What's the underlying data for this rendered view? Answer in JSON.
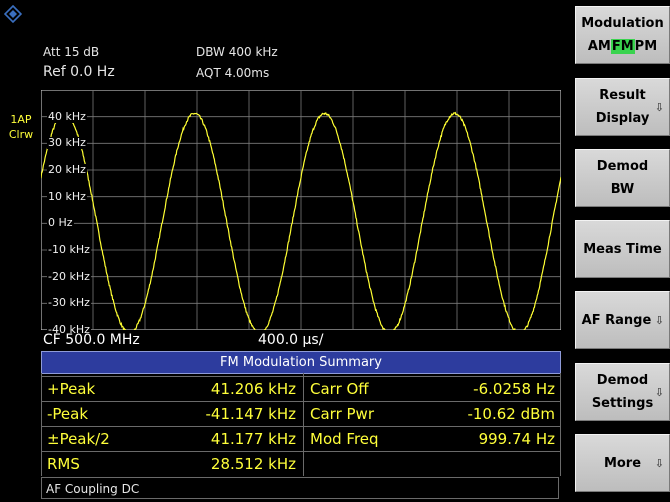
{
  "header": {
    "att_label": "Att  15 dB",
    "ref_label": "Ref  0.0 Hz",
    "dbw_label": "DBW 400 kHz",
    "aqt_label": "AQT  4.00ms"
  },
  "side_labels": {
    "trace": "1AP",
    "mode": "Clrw"
  },
  "logo_icon": "rohde-schwarz-logo-icon",
  "chart_data": {
    "type": "line",
    "x_axis": {
      "center_label": "CF 500.0 MHz",
      "div_label": "400.0 µs/",
      "divisions": 10,
      "sweep_time_ms": 4.0
    },
    "y_axis": {
      "ticks": [
        "40 kHz",
        "30 kHz",
        "20 kHz",
        "10 kHz",
        "0 Hz",
        "-10 kHz",
        "-20 kHz",
        "-30 kHz",
        "-40 kHz"
      ],
      "ylim_khz": [
        -40,
        50
      ]
    },
    "series": [
      {
        "signal": "sine",
        "amplitude_khz": 41.177,
        "offset_khz": 0,
        "frequency_hz": 999.74,
        "start_phase_deg": 25,
        "color": "#ffff33"
      }
    ],
    "grid": true
  },
  "summary": {
    "title": "FM Modulation Summary",
    "rows": [
      {
        "label": "+Peak",
        "value": "41.206 kHz",
        "label2": "Carr Off",
        "value2": "-6.0258 Hz"
      },
      {
        "label": "-Peak",
        "value": "-41.147 kHz",
        "label2": "Carr Pwr",
        "value2": "-10.62 dBm"
      },
      {
        "label": "±Peak/2",
        "value": "41.177 kHz",
        "label2": "Mod Freq",
        "value2": "999.74 Hz"
      },
      {
        "label": "RMS",
        "value": "28.512 kHz",
        "label2": "",
        "value2": ""
      }
    ],
    "footer": "AF Coupling DC"
  },
  "softkeys": {
    "modulation": {
      "line1": "Modulation",
      "am": "AM",
      "fm": "FM",
      "pm": "PM"
    },
    "result_display": {
      "line1": "Result",
      "line2": "Display",
      "arrow": "⇩"
    },
    "demod_bw": {
      "line1": "Demod",
      "line2": "BW"
    },
    "meas_time": {
      "line1": "Meas Time"
    },
    "af_range": {
      "line1": "AF Range",
      "arrow": "⇩"
    },
    "demod_settings": {
      "line1": "Demod",
      "line2": "Settings",
      "arrow": "⇩"
    },
    "more": {
      "line1": "More",
      "arrow": "⇩"
    }
  },
  "colors": {
    "trace": "#ffff33",
    "title_bar": "#2d3c9e",
    "active_mod": "#39d34e",
    "value_text": "#ffff3a"
  }
}
